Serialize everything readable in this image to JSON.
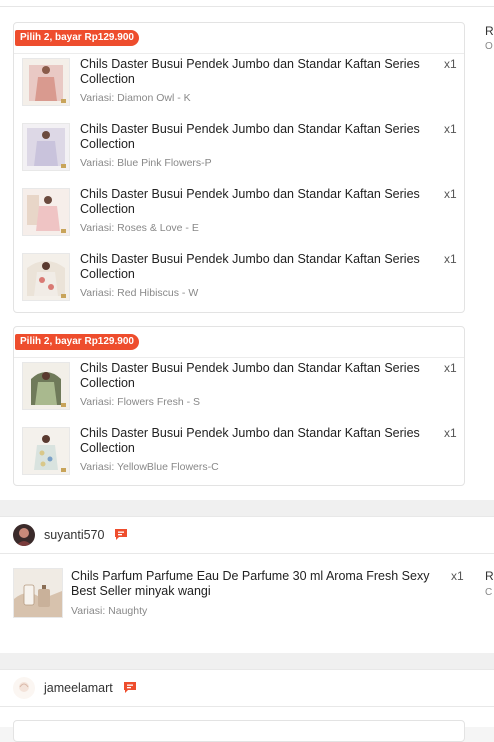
{
  "groups": [
    {
      "promo_label": "Pilih 2, bayar Rp129.900",
      "items": [
        {
          "name": "Chils Daster Busui Pendek Jumbo dan Standar Kaftan Series Collection",
          "qty": "x1",
          "variant": "Variasi: Diamon Owl - K",
          "thumb_color": "#e9c9c4"
        },
        {
          "name": "Chils Daster Busui Pendek Jumbo dan Standar Kaftan Series Collection",
          "qty": "x1",
          "variant": "Variasi: Blue Pink Flowers-P",
          "thumb_color": "#c9c3dc"
        },
        {
          "name": "Chils Daster Busui Pendek Jumbo dan Standar Kaftan Series Collection",
          "qty": "x1",
          "variant": "Variasi: Roses & Love - E",
          "thumb_color": "#efc4c4"
        },
        {
          "name": "Chils Daster Busui Pendek Jumbo dan Standar Kaftan Series Collection",
          "qty": "x1",
          "variant": "Variasi: Red Hibiscus - W",
          "thumb_color": "#d97a74"
        }
      ]
    },
    {
      "promo_label": "Pilih 2, bayar Rp129.900",
      "items": [
        {
          "name": "Chils Daster Busui Pendek Jumbo dan Standar Kaftan Series Collection",
          "qty": "x1",
          "variant": "Variasi: Flowers Fresh - S",
          "thumb_color": "#a9b98e"
        },
        {
          "name": "Chils Daster Busui Pendek Jumbo dan Standar Kaftan Series Collection",
          "qty": "x1",
          "variant": "Variasi: YellowBlue Flowers-C",
          "thumb_color": "#d9c88a"
        }
      ]
    }
  ],
  "right_column": {
    "top_letter": "R",
    "top_sub": "O",
    "item_letter": "R",
    "item_sub": "C"
  },
  "shops": [
    {
      "name": "suyanti570",
      "avatar_color": "#7a3b3b"
    },
    {
      "name": "jameelamart",
      "avatar_color": "#f3e3da"
    }
  ],
  "shop_item": {
    "name": "Chils Parfum Parfume Eau De Parfume 30 ml Aroma Fresh Sexy Best Seller minyak wangi",
    "qty": "x1",
    "variant": "Variasi: Naughty",
    "thumb_color": "#d7c2ad"
  },
  "colors": {
    "accent": "#ee4d2d",
    "chat": "#ee4d2d"
  }
}
